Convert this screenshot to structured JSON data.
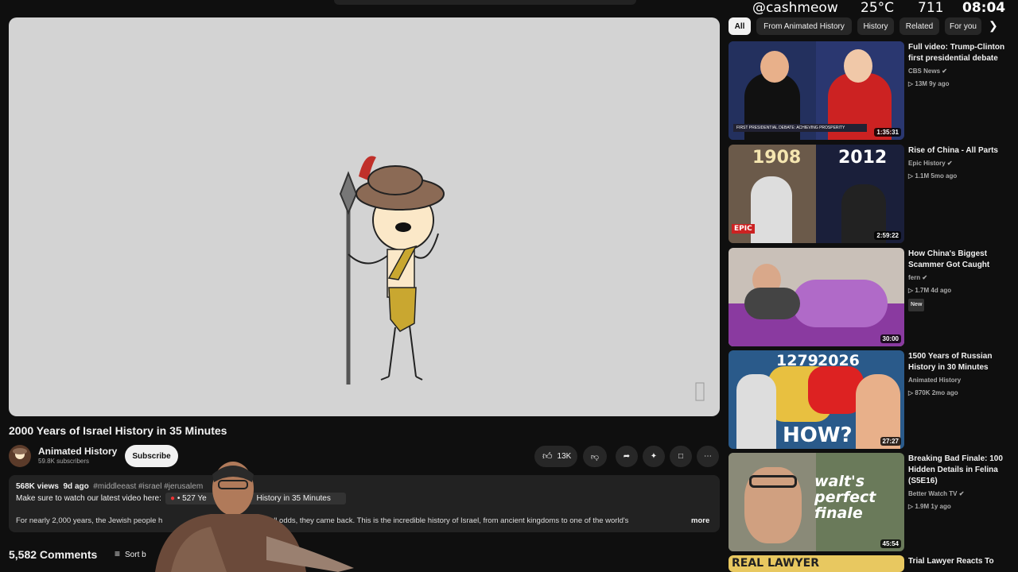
{
  "overlay": {
    "handle": "@cashmeow",
    "temp": "25°C",
    "count": "711",
    "time": "08:04"
  },
  "video": {
    "title": "2000 Years of Israel History in 35 Minutes"
  },
  "channel": {
    "name": "Animated History",
    "subscribers": "59.8K subscribers",
    "subscribe_label": "Subscribe"
  },
  "actions": {
    "likes": "13K"
  },
  "description": {
    "views": "568K views",
    "age": "9d ago",
    "tags": "#middleeast #israel #jerusalem",
    "line2": "Make sure to watch our latest video here:",
    "link_prefix": "• 527 Ye",
    "link_suffix": "History in 35 Minutes",
    "body": "For nearly 2,000 years, the Jewish people h",
    "body2": "n. Then, against all odds, they came back. This is the incredible history of Israel, from ancient kingdoms to one of the world's",
    "more": "more"
  },
  "comments": {
    "count_label": "5,582 Comments",
    "sort_label": "Sort b"
  },
  "chips": [
    "All",
    "From Animated History",
    "History",
    "Related",
    "For you"
  ],
  "recommendations": [
    {
      "title": "Full video: Trump-Clinton first presidential debate",
      "channel": "CBS News",
      "meta": "▷ 13M  9y ago",
      "duration": "1:35:31",
      "thumb_text": "FIRST PRESIDENTIAL DEBATE: ACHIEVING PROSPERITY"
    },
    {
      "title": "Rise of China - All Parts",
      "channel": "Epic History",
      "meta": "▷ 1.1M  5mo ago",
      "duration": "2:59:22",
      "thumb_left": "1908",
      "thumb_right": "2012",
      "thumb_logo": "EPIC"
    },
    {
      "title": "How China's Biggest Scammer Got Caught",
      "channel": "fern",
      "meta": "▷ 1.7M  4d ago",
      "badge": "New",
      "duration": "30:00"
    },
    {
      "title": "1500 Years of Russian History in 30 Minutes",
      "channel": "Animated History",
      "meta": "▷ 870K  2mo ago",
      "duration": "27:27",
      "thumb_left": "1279",
      "thumb_right": "2026",
      "thumb_big": "HOW?"
    },
    {
      "title": "Breaking Bad Finale: 100 Hidden Details in Felina (S5E16)",
      "channel": "Better Watch TV",
      "meta": "▷ 1.9M  1y ago",
      "duration": "45:54",
      "thumb_big": "walt's perfect finale"
    },
    {
      "title": "Trial Lawyer Reacts To",
      "thumb_big": "REAL LAWYER"
    }
  ],
  "colors": {
    "background": "#0f0f0f",
    "player": "#d3d3d3",
    "chip_active": "#f1f1f1",
    "chip": "#272727"
  }
}
